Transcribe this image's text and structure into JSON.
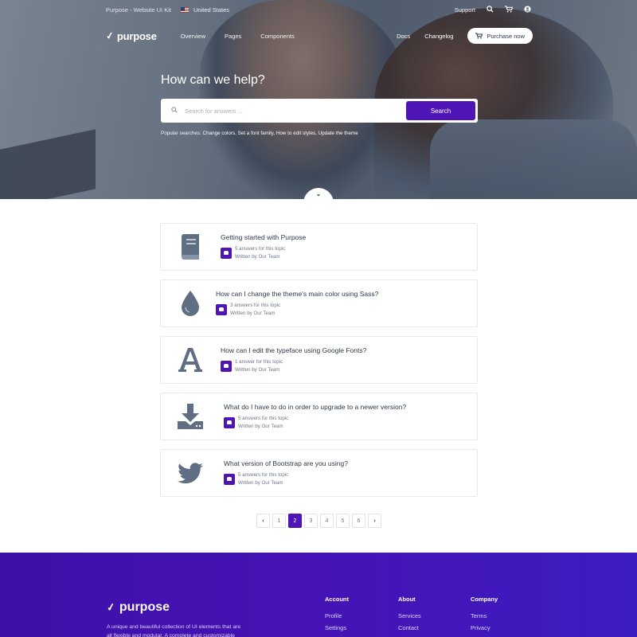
{
  "topbar": {
    "kit_label": "Purpose - Website UI Kit",
    "country": "United States",
    "support": "Support",
    "icons": [
      "search-icon",
      "cart-icon",
      "user-icon"
    ]
  },
  "navbar": {
    "brand": "purpose",
    "links": [
      "Overview",
      "Pages",
      "Components"
    ],
    "docs": "Docs",
    "changelog": "Changelog",
    "purchase": "Purchase now"
  },
  "hero": {
    "title": "How can we help?",
    "search_placeholder": "Search for answers ...",
    "search_button": "Search",
    "popular_label": "Popular searches:",
    "popular_links": [
      "Change colors",
      "Set a font family",
      "How to edit styles",
      "Update the theme"
    ]
  },
  "topics": [
    {
      "title": "Getting started with Purpose",
      "answers": "5 answers for this topic",
      "author": "Written by Our Team",
      "icon": "book-icon"
    },
    {
      "title": "How can I change the theme's main color using Sass?",
      "answers": "3 answers for this topic",
      "author": "Written by Our Team",
      "icon": "drop-icon"
    },
    {
      "title": "How can I edit the typeface using Google Fonts?",
      "answers": "1 answer for this topic",
      "author": "Written by Our Team",
      "icon": "font-icon"
    },
    {
      "title": "What do I have to do in order to upgrade to a newer version?",
      "answers": "5 answers for this topic",
      "author": "Written by Our Team",
      "icon": "download-icon"
    },
    {
      "title": "What version of Bootstrap are you using?",
      "answers": "5 answers for this topic",
      "author": "Written by Our Team",
      "icon": "twitter-icon"
    }
  ],
  "pagination": {
    "pages": [
      "1",
      "2",
      "3",
      "4",
      "5",
      "6"
    ],
    "current": "2",
    "prev": "‹",
    "next": "›"
  },
  "footer": {
    "brand": "purpose",
    "description": "A unique and beautiful collection of UI elements that are all flexible and modular. A complete and customizable",
    "columns": [
      {
        "heading": "Account",
        "links": [
          "Profile",
          "Settings"
        ]
      },
      {
        "heading": "About",
        "links": [
          "Services",
          "Contact"
        ]
      },
      {
        "heading": "Company",
        "links": [
          "Terms",
          "Privacy"
        ]
      }
    ]
  },
  "colors": {
    "primary": "#4e14b5",
    "footer_bg": "#4212b0",
    "icon": "#5f6e82",
    "text": "#2d3a4a"
  }
}
